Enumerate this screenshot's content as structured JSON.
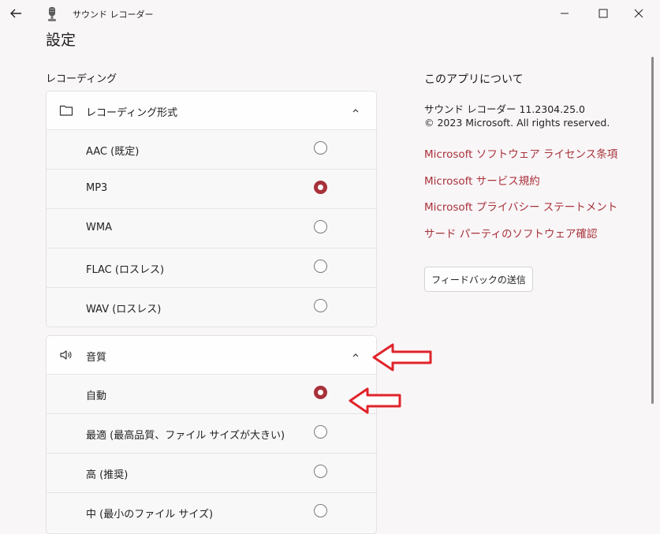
{
  "window": {
    "title": "サウンド レコーダー",
    "back_icon": "back-arrow-icon",
    "app_icon": "microphone-icon"
  },
  "page": {
    "title": "設定",
    "section_label": "レコーディング"
  },
  "format_card": {
    "header_icon": "folder-icon",
    "header": "レコーディング形式",
    "options": [
      {
        "label": "AAC (既定)",
        "selected": false
      },
      {
        "label": "MP3",
        "selected": true
      },
      {
        "label": "WMA",
        "selected": false
      },
      {
        "label": "FLAC (ロスレス)",
        "selected": false
      },
      {
        "label": "WAV (ロスレス)",
        "selected": false
      }
    ]
  },
  "quality_card": {
    "header_icon": "speaker-icon",
    "header": "音質",
    "options": [
      {
        "label": "自動",
        "selected": true
      },
      {
        "label": "最適 (最高品質、ファイル サイズが大きい)",
        "selected": false
      },
      {
        "label": "高 (推奨)",
        "selected": false
      },
      {
        "label": "中 (最小のファイル サイズ)",
        "selected": false
      }
    ]
  },
  "about": {
    "title": "このアプリについて",
    "version": "サウンド レコーダー 11.2304.25.0",
    "copyright": "© 2023 Microsoft. All rights reserved.",
    "links": [
      "Microsoft ソフトウェア ライセンス条項",
      "Microsoft サービス規約",
      "Microsoft プライバシー ステートメント",
      "サード パーティのソフトウェア確認"
    ],
    "feedback_button": "フィードバックの送信"
  },
  "colors": {
    "accent": "#a8323a",
    "annotation_arrow": "#e0242a",
    "background": "#f9f6f8"
  }
}
